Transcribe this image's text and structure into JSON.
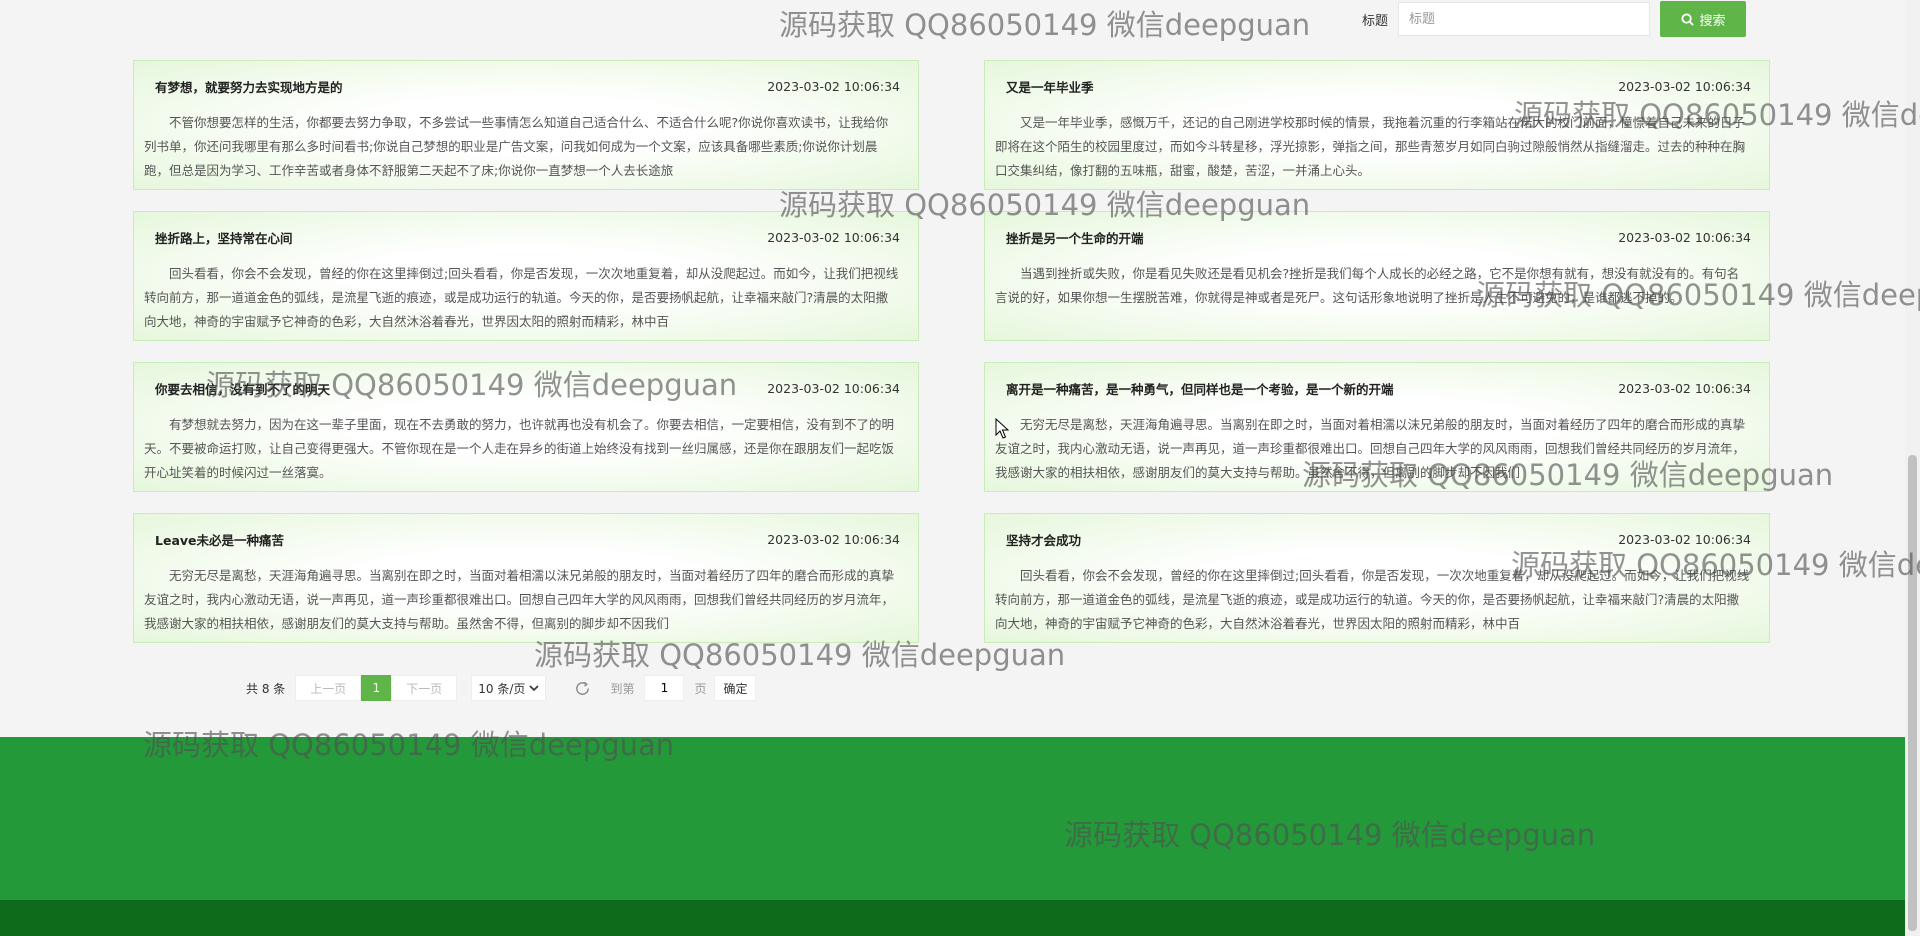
{
  "search": {
    "label": "标题",
    "placeholder": "标题",
    "button_label": "搜索"
  },
  "cards": [
    {
      "title": "有梦想，就要努力去实现地方是的",
      "date": "2023-03-02 10:06:34",
      "body": "不管你想要怎样的生活，你都要去努力争取，不多尝试一些事情怎么知道自己适合什么、不适合什么呢?你说你喜欢读书，让我给你列书单，你还问我哪里有那么多时间看书;你说自己梦想的职业是广告文案，问我如何成为一个文案，应该具备哪些素质;你说你计划晨跑，但总是因为学习、工作辛苦或者身体不舒服第二天起不了床;你说你一直梦想一个人去长途旅"
    },
    {
      "title": "又是一年毕业季",
      "date": "2023-03-02 10:06:34",
      "body": "又是一年毕业季，感慨万千，还记的自己刚进学校那时候的情景，我拖着沉重的行李箱站在偌大的校门前面，憧憬着自己未来的日子即将在这个陌生的校园里度过，而如今斗转星移，浮光掠影，弹指之间，那些青葱岁月如同白驹过隙般悄然从指缝溜走。过去的种种在胸口交集纠结，像打翻的五味瓶，甜蜜，酸楚，苦涩，一并涌上心头。"
    },
    {
      "title": "挫折路上，坚持常在心间",
      "date": "2023-03-02 10:06:34",
      "body": "回头看看，你会不会发现，曾经的你在这里摔倒过;回头看看，你是否发现，一次次地重复着，却从没爬起过。而如今，让我们把视线转向前方，那一道道金色的弧线，是流星飞逝的痕迹，或是成功运行的轨道。今天的你，是否要扬帆起航，让幸福来敲门?清晨的太阳撒向大地，神奇的宇宙赋予它神奇的色彩，大自然沐浴着春光，世界因太阳的照射而精彩，林中百"
    },
    {
      "title": "挫折是另一个生命的开端",
      "date": "2023-03-02 10:06:34",
      "body": "当遇到挫折或失败，你是看见失败还是看见机会?挫折是我们每个人成长的必经之路，它不是你想有就有，想没有就没有的。有句名言说的好，如果你想一生摆脱苦难，你就得是神或者是死尸。这句话形象地说明了挫折是人生不可避免的，是谁都逃不掉的。"
    },
    {
      "title": "你要去相信，没有到不了的明天",
      "date": "2023-03-02 10:06:34",
      "body": "有梦想就去努力，因为在这一辈子里面，现在不去勇敢的努力，也许就再也没有机会了。你要去相信，一定要相信，没有到不了的明天。不要被命运打败，让自己变得更强大。不管你现在是一个人走在异乡的街道上始终没有找到一丝归属感，还是你在跟朋友们一起吃饭开心址笑着的时候闪过一丝落寞。"
    },
    {
      "title": "离开是一种痛苦，是一种勇气，但同样也是一个考验，是一个新的开端",
      "date": "2023-03-02 10:06:34",
      "body": "无穷无尽是离愁，天涯海角遍寻思。当离别在即之时，当面对着相濡以沫兄弟般的朋友时，当面对着经历了四年的磨合而形成的真挚友谊之时，我内心激动无语，说一声再见，道一声珍重都很难出口。回想自己四年大学的风风雨雨，回想我们曾经共同经历的岁月流年，我感谢大家的相扶相依，感谢朋友们的莫大支持与帮助。虽然舍不得，但离别的脚步却不因我们"
    },
    {
      "title": "Leave未必是一种痛苦",
      "date": "2023-03-02 10:06:34",
      "body": "无穷无尽是离愁，天涯海角遍寻思。当离别在即之时，当面对着相濡以沫兄弟般的朋友时，当面对着经历了四年的磨合而形成的真挚友谊之时，我内心激动无语，说一声再见，道一声珍重都很难出口。回想自己四年大学的风风雨雨，回想我们曾经共同经历的岁月流年，我感谢大家的相扶相依，感谢朋友们的莫大支持与帮助。虽然舍不得，但离别的脚步却不因我们"
    },
    {
      "title": "坚持才会成功",
      "date": "2023-03-02 10:06:34",
      "body": "回头看看，你会不会发现，曾经的你在这里摔倒过;回头看看，你是否发现，一次次地重复着，却从没爬起过。而如今，让我们把视线转向前方，那一道道金色的弧线，是流星飞逝的痕迹，或是成功运行的轨道。今天的你，是否要扬帆起航，让幸福来敲门?清晨的太阳撒向大地，神奇的宇宙赋予它神奇的色彩，大自然沐浴着春光，世界因太阳的照射而精彩，林中百"
    }
  ],
  "pagination": {
    "total": "共 8 条",
    "prev": "上一页",
    "current": "1",
    "next": "下一页",
    "page_size": "10 条/页",
    "goto_label": "到第",
    "goto_value": "1",
    "page_unit": "页",
    "confirm": "确定"
  },
  "watermark": "源码获取 QQ86050149 微信deepguan",
  "colors": {
    "accent": "#5fb547",
    "footer": "#24993a",
    "footer_bottom": "#0e6b1c"
  },
  "icons": {
    "search": "search-icon",
    "refresh": "refresh-icon",
    "dropdown": "chevron-down-icon"
  }
}
